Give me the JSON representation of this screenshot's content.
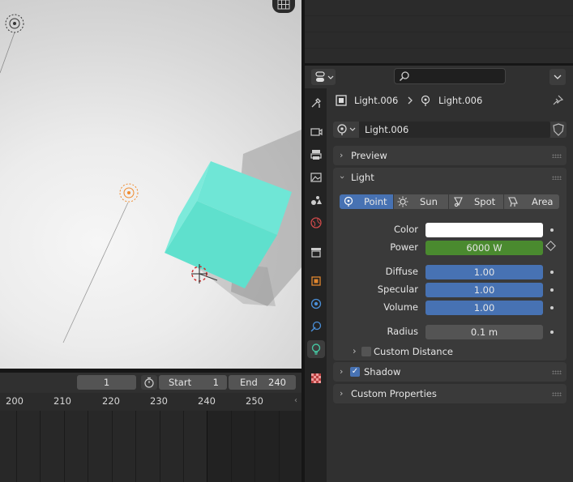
{
  "viewport": {
    "object_color": "#5ee0cc",
    "floor_color": "#ececec"
  },
  "timeline": {
    "current_frame": "1",
    "start_label": "Start",
    "start_value": "1",
    "end_label": "End",
    "end_value": "240",
    "ruler_ticks": [
      "200",
      "210",
      "220",
      "230",
      "240",
      "250"
    ]
  },
  "properties": {
    "breadcrumb": {
      "object": "Light.006",
      "data": "Light.006"
    },
    "datablock_name": "Light.006",
    "panels": {
      "preview": "Preview",
      "light": "Light",
      "shadow": "Shadow",
      "custom_properties": "Custom Properties"
    },
    "light_types": [
      "Point",
      "Sun",
      "Spot",
      "Area"
    ],
    "fields": {
      "color_label": "Color",
      "power_label": "Power",
      "power_value": "6000 W",
      "diffuse_label": "Diffuse",
      "diffuse_value": "1.00",
      "specular_label": "Specular",
      "specular_value": "1.00",
      "volume_label": "Volume",
      "volume_value": "1.00",
      "radius_label": "Radius",
      "radius_value": "0.1 m",
      "custom_distance_label": "Custom Distance"
    },
    "colors": {
      "accent": "#4772b3",
      "power_green": "#4a8a2f",
      "light_color": "#ffffff"
    }
  }
}
